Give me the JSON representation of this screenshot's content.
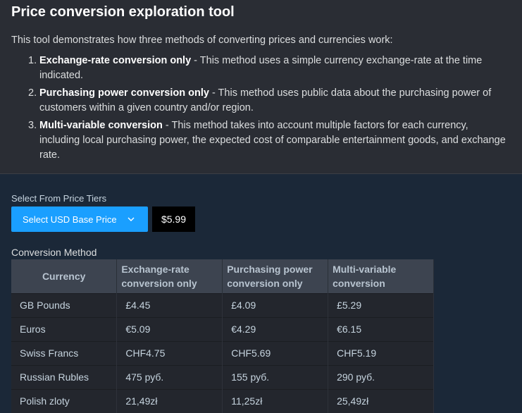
{
  "intro": {
    "title": "Price conversion exploration tool",
    "description": "This tool demonstrates how three methods of converting prices and currencies work:",
    "methods": [
      {
        "num": "1.",
        "name": "Exchange-rate conversion only",
        "desc": " - This method uses a simple currency exchange-rate at the time indicated."
      },
      {
        "num": "2.",
        "name": "Purchasing power conversion only",
        "desc": " - This method uses public data about the purchasing power of customers within a given country and/or region."
      },
      {
        "num": "3.",
        "name": "Multi-variable conversion",
        "desc": " - This method takes into account multiple factors for each currency, including local purchasing power, the expected cost of comparable entertainment goods, and exchange rate."
      }
    ]
  },
  "controls": {
    "tier_label": "Select From Price Tiers",
    "select_label": "Select USD Base Price",
    "price": "$5.99"
  },
  "table": {
    "label": "Conversion Method",
    "headers": [
      "Currency",
      "Exchange-rate conversion only",
      "Purchasing power conversion only",
      "Multi-variable conversion"
    ],
    "rows": [
      [
        "GB Pounds",
        "£4.45",
        "£4.09",
        "£5.29"
      ],
      [
        "Euros",
        "€5.09",
        "€4.29",
        "€6.15"
      ],
      [
        "Swiss Francs",
        "CHF4.75",
        "CHF5.69",
        "CHF5.19"
      ],
      [
        "Russian Rubles",
        "475 руб.",
        "155 руб.",
        "290 руб."
      ],
      [
        "Polish zloty",
        "21,49zł",
        "11,25zł",
        "25,49zł"
      ]
    ]
  },
  "colors": {
    "background": "#1b2838",
    "intro_bg": "#2a2d34",
    "accent": "#1a9fff",
    "header_bg": "#3d4450",
    "cell_bg": "#23262d"
  },
  "icons": {
    "dropdown": "chevron-down-icon"
  }
}
